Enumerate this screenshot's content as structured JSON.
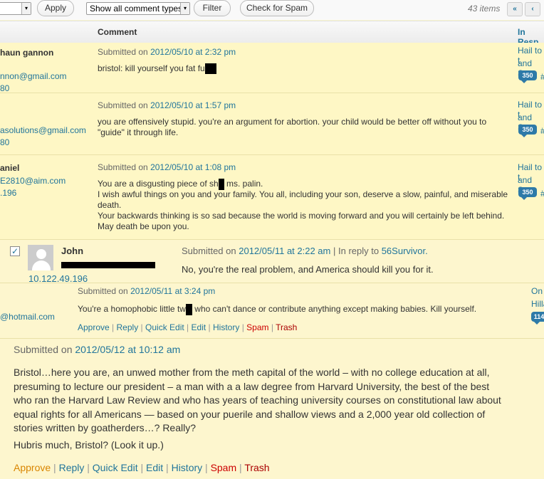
{
  "toolbar": {
    "approve_label": "Apply",
    "comment_types_value": "Show all comment types",
    "filter_label": "Filter",
    "check_spam_label": "Check for Spam",
    "items_count": "43 items",
    "first_page": "«",
    "prev_page": "‹"
  },
  "table": {
    "col_comment": "Comment",
    "col_response": "In Resp"
  },
  "rows": [
    {
      "author_name": "haun gannon",
      "author_email": "nnon@gmail.com",
      "author_ip": "80",
      "submitted_prefix": "Submitted on",
      "date": "2012/05/10 at 2:32 pm",
      "text": "bristol: kill yourself you fat fu",
      "resp_line1": "Hail to t",
      "resp_line2": "and Sas",
      "bubble": "350",
      "hash": "#"
    },
    {
      "author_email": "asolutions@gmail.com",
      "author_ip": "80",
      "submitted_prefix": "Submitted on",
      "date": "2012/05/10 at 1:57 pm",
      "text1": "you are offensively stupid. you're an argument for abortion. your child would be better off without you to",
      "text2": "\"guide\" it through life.",
      "resp_line1": "Hail to t",
      "resp_line2": "and Sas",
      "bubble": "350",
      "hash": "#"
    },
    {
      "author_name": "aniel",
      "author_email": "E2810@aim.com",
      "author_ip": ".196",
      "submitted_prefix": "Submitted on",
      "date": "2012/05/10 at 1:08 pm",
      "text1a": "You are a disgusting piece of sh",
      "text1b": " ms. palin.",
      "text2": "I wish awful things on you and your family. You all, including your son, deserve a slow, painful, and miserable",
      "text3": "death.",
      "text4": "Your backwards thinking is so sad because the world is moving forward and you will certainly be left behind.",
      "text5": "May death be upon you.",
      "resp_line1": "Hail to t",
      "resp_line2": "and Sas",
      "bubble": "350",
      "hash": "#"
    }
  ],
  "zoom_row1": {
    "author_name": "John",
    "author_ip": "10.122.49.196",
    "submitted_prefix": "Submitted on",
    "date": "2012/05/11 at 2:22 am",
    "reply_prefix": "| In reply to",
    "reply_to": "56Survivor.",
    "text": "No, you're the real problem, and America should kill you for it."
  },
  "zoom_row2": {
    "author_email": "@hotmail.com",
    "submitted_prefix": "Submitted on",
    "date": "2012/05/11 at 3:24 pm",
    "text_a": "You're a homophobic little tw",
    "text_b": " who can't dance or contribute anything except making babies. Kill yourself.",
    "resp_line1": "On",
    "resp_line2": "Hilla",
    "bubble": "114",
    "actions": {
      "approve": "Approve",
      "reply": "Reply",
      "quick_edit": "Quick Edit",
      "edit": "Edit",
      "history": "History",
      "spam": "Spam",
      "trash": "Trash"
    }
  },
  "zoom_row3": {
    "submitted_prefix": "Submitted on",
    "date": "2012/05/12 at 10:12 am",
    "para1_lines": [
      "Bristol…here you are, an unwed mother from the meth capital of the world – with no college education at all,",
      "presuming to lecture our president – a man with a a law degree from Harvard University, the best of the best",
      "who ran the Harvard Law Review and who has years of teaching university courses on constitutional law about",
      "equal rights for all Americans — based on your puerile and shallow views and a 2,000 year old collection of",
      "stories written by goatherders…? Really?"
    ],
    "para2": "Hubris much, Bristol? (Look it up.)",
    "actions": {
      "approve": "Approve",
      "reply": "Reply",
      "quick_edit": "Quick Edit",
      "edit": "Edit",
      "history": "History",
      "spam": "Spam",
      "trash": "Trash"
    }
  },
  "separator": "|"
}
